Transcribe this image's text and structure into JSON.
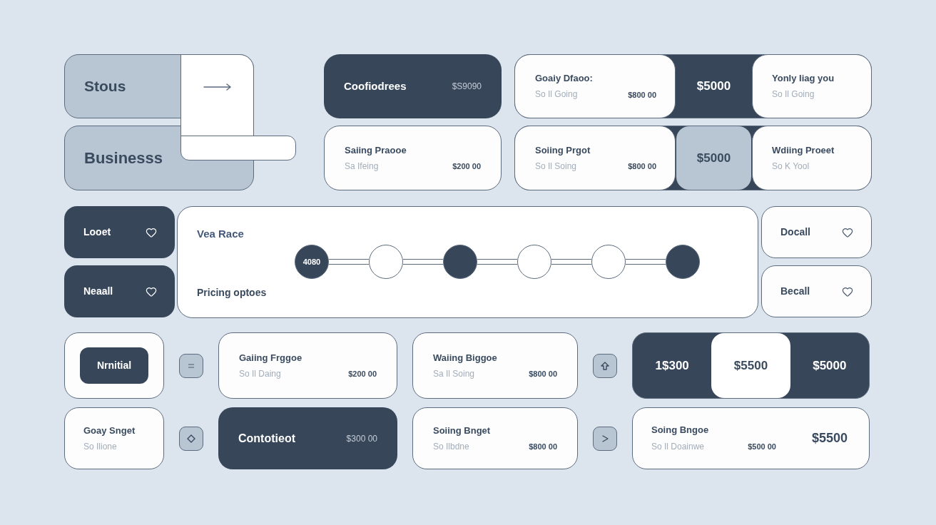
{
  "side_tabs": [
    {
      "label": "Stous"
    },
    {
      "label": "Businesss"
    }
  ],
  "plan_cards": [
    {
      "kind": "dark",
      "title": "Coofiodrees",
      "price": "$S9090"
    },
    {
      "kind": "light",
      "title": "Saiing Praooe",
      "subtitle": "Sa Ifeing",
      "price": "$200 00"
    }
  ],
  "compare_rows": [
    {
      "left": {
        "title": "Goaiy Dfaoo:",
        "subtitle": "So Il Going",
        "price": "$800 00"
      },
      "middle": {
        "kind": "dark",
        "price": "$5000"
      },
      "right": {
        "title": "Yonly Iiag you",
        "subtitle": "So Il Going"
      }
    },
    {
      "left": {
        "title": "Soiing Prgot",
        "subtitle": "So Il Soing",
        "price": "$800 00"
      },
      "middle": {
        "kind": "muted",
        "price": "$5000"
      },
      "right": {
        "title": "Wdiing Proeet",
        "subtitle": "So K Yool"
      }
    }
  ],
  "left_buttons": [
    {
      "label": "Looet"
    },
    {
      "label": "Neaall"
    }
  ],
  "steps_panel": {
    "title": "Vea Race",
    "subtitle": "Pricing optoes",
    "steps": [
      {
        "active": true,
        "label": "4080"
      },
      {
        "active": false
      },
      {
        "active": true
      },
      {
        "active": false
      },
      {
        "active": false
      },
      {
        "active": true
      }
    ]
  },
  "right_buttons": [
    {
      "label": "Docall"
    },
    {
      "label": "Becall"
    }
  ],
  "bottom_rows": [
    {
      "start": {
        "kind": "button",
        "label": "Nrnitial"
      },
      "middle": {
        "kind": "light",
        "title": "Gaiing Frggoe",
        "subtitle": "So Il Daing",
        "price": "$200 00"
      },
      "side": {
        "title": "Waiing Biggoe",
        "subtitle": "Sa Il Soing",
        "price": "$800 00"
      },
      "end": {
        "kind": "switch",
        "options": [
          {
            "label": "1$300",
            "selected": false
          },
          {
            "label": "$5500",
            "selected": true
          },
          {
            "label": "$5000",
            "selected": false
          }
        ]
      }
    },
    {
      "start": {
        "kind": "text",
        "title": "Goay Snget",
        "subtitle": "So Ilione"
      },
      "middle": {
        "kind": "dark",
        "title": "Contotieot",
        "price": "$300 00"
      },
      "side": {
        "title": "Soiing Bnget",
        "subtitle": "So Ilbdne",
        "price": "$800 00"
      },
      "end": {
        "kind": "summary",
        "title": "Soing Bngoe",
        "subtitle": "So Il Doainwe",
        "price": "$500 00",
        "total": "$5500"
      }
    }
  ]
}
